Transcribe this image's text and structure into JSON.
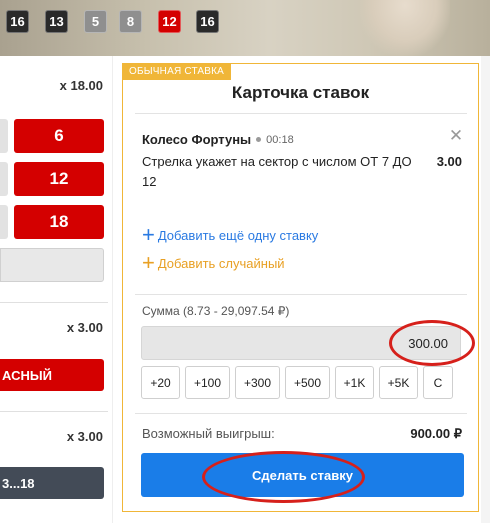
{
  "history": [
    {
      "value": "16",
      "color": "black"
    },
    {
      "value": "13",
      "color": "black"
    },
    {
      "value": "5",
      "color": "gray"
    },
    {
      "value": "8",
      "color": "gray"
    },
    {
      "value": "12",
      "color": "red"
    },
    {
      "value": "16",
      "color": "black"
    }
  ],
  "left_panel": {
    "odds_top": "x 18.00",
    "numbers": [
      "6",
      "12",
      "18"
    ],
    "odds_mid": "x 3.00",
    "red_bet_label": "АСНЫЙ",
    "odds_bottom": "x 3.00",
    "range_bet_label": "3...18"
  },
  "bet_slip": {
    "tag": "ОБЫЧНАЯ СТАВКА",
    "title": "Карточка ставок",
    "event_name": "Колесо Фортуны",
    "event_time": "00:18",
    "pick_text": "Стрелка укажет на сектор с числом ОТ 7 ДО 12",
    "pick_odds": "3.00",
    "add_another": "Добавить ещё одну ставку",
    "add_random": "Добавить случайный",
    "sum_label": "Сумма (8.73 - 29,097.54 ₽)",
    "sum_value": "300.00",
    "quick_amounts": [
      "+20",
      "+100",
      "+300",
      "+500",
      "+1K",
      "+5K",
      "C"
    ],
    "win_label": "Возможный выигрыш:",
    "win_value": "900.00 ₽",
    "place_button": "Сделать ставку"
  },
  "colors": {
    "accent_blue": "#1a7de8",
    "bet_red": "#d40000",
    "slip_border": "#f0b638",
    "annotation_ring": "#d6201b"
  },
  "icons": [
    "plus-icon",
    "close-icon",
    "live-dot-icon"
  ]
}
